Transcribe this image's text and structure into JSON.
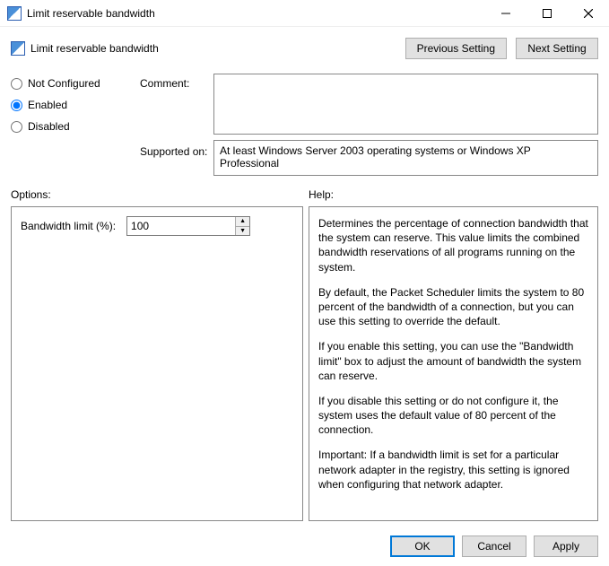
{
  "window": {
    "title": "Limit reservable bandwidth"
  },
  "header": {
    "policy_title": "Limit reservable bandwidth",
    "prev_btn": "Previous Setting",
    "next_btn": "Next Setting"
  },
  "state": {
    "not_configured": "Not Configured",
    "enabled": "Enabled",
    "disabled": "Disabled",
    "selected": "enabled"
  },
  "labels": {
    "comment": "Comment:",
    "supported": "Supported on:",
    "options": "Options:",
    "help": "Help:"
  },
  "fields": {
    "comment_value": "",
    "supported_text": "At least Windows Server 2003 operating systems or Windows XP Professional"
  },
  "options": {
    "bandwidth_label": "Bandwidth limit (%):",
    "bandwidth_value": "100"
  },
  "help": {
    "p1": "Determines the percentage of connection bandwidth that the system can reserve. This value limits the combined bandwidth reservations of all programs running on the system.",
    "p2": "By default, the Packet Scheduler limits the system to 80 percent of the bandwidth of a connection, but you can use this setting to override the default.",
    "p3": "If you enable this setting, you can use the \"Bandwidth limit\" box to adjust the amount of bandwidth the system can reserve.",
    "p4": "If you disable this setting or do not configure it, the system uses the default value of 80 percent of the connection.",
    "p5": "Important: If a bandwidth limit is set for a particular network adapter in the registry, this setting is ignored when configuring that network adapter."
  },
  "footer": {
    "ok": "OK",
    "cancel": "Cancel",
    "apply": "Apply"
  }
}
